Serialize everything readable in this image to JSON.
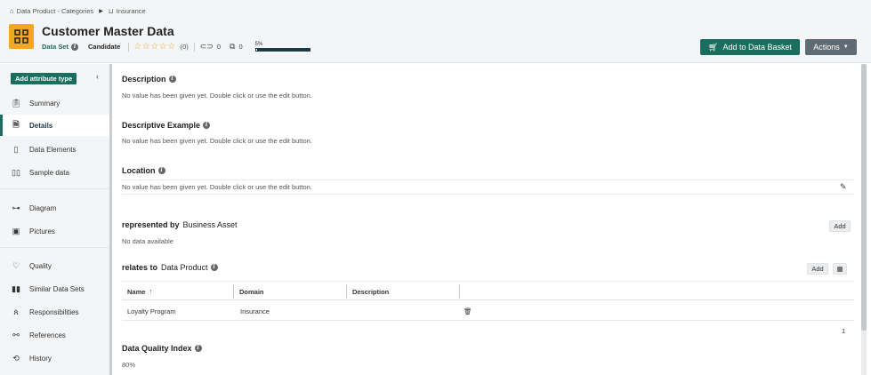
{
  "breadcrumb": {
    "root": "Data Product - Categories",
    "current": "Insurance"
  },
  "asset": {
    "title": "Customer Master Data",
    "type": "Data Set",
    "status": "Candidate",
    "stars": "☆☆☆☆☆",
    "rating_count": "(0)",
    "tags_count": "0",
    "copies_count": "0",
    "progress_label": "5%",
    "progress_value": 0.05
  },
  "header_buttons": {
    "basket": "Add to Data Basket",
    "actions": "Actions"
  },
  "sidebar": {
    "add_attribute": "Add attribute type",
    "items": [
      {
        "label": "Summary",
        "icon": "clipboard-icon"
      },
      {
        "label": "Details",
        "icon": "document-icon"
      },
      {
        "label": "Data Elements",
        "icon": "column-icon"
      },
      {
        "label": "Sample data",
        "icon": "columns-icon"
      },
      {
        "label": "Diagram",
        "icon": "diagram-icon"
      },
      {
        "label": "Pictures",
        "icon": "picture-icon"
      },
      {
        "label": "Quality",
        "icon": "quality-icon"
      },
      {
        "label": "Similar Data Sets",
        "icon": "similar-icon"
      },
      {
        "label": "Responsibilities",
        "icon": "people-icon"
      },
      {
        "label": "References",
        "icon": "references-icon"
      },
      {
        "label": "History",
        "icon": "history-icon"
      }
    ]
  },
  "sections": {
    "description": {
      "title": "Description",
      "value": "No value has been given yet. Double click or use the edit button."
    },
    "descriptive_example": {
      "title": "Descriptive Example",
      "value": "No value has been given yet. Double click or use the edit button."
    },
    "location": {
      "title": "Location",
      "value": "No value has been given yet. Double click or use the edit button."
    },
    "represented_by": {
      "title": "represented by",
      "target": "Business Asset",
      "value": "No data available",
      "add": "Add"
    },
    "relates_to": {
      "title": "relates to",
      "target": "Data Product",
      "add": "Add"
    },
    "dqi": {
      "title": "Data Quality Index",
      "value": "80%"
    }
  },
  "table": {
    "columns": [
      "Name",
      "Domain",
      "Description"
    ],
    "rows": [
      {
        "name": "Loyalty Program",
        "domain": "Insurance",
        "description": ""
      }
    ],
    "page": "1"
  },
  "colors": {
    "accent": "#1a6e5f",
    "logo": "#f5a623",
    "actions": "#5f6b74"
  }
}
